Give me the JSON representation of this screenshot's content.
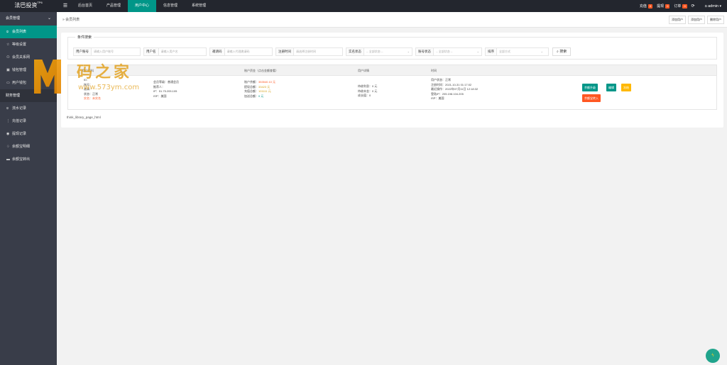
{
  "app": {
    "logo": "法巴投资",
    "logo_sup": "TP6",
    "menu_icon": "hamburger-icon"
  },
  "nav": [
    "后台首页",
    "产品管理",
    "用户中心",
    "信息管理",
    "系统管理"
  ],
  "topright": {
    "recharge": "充值",
    "recharge_count": "0",
    "withdraw": "提现",
    "withdraw_count": "0",
    "orders": "订单",
    "orders_count": "0",
    "refresh_icon": "refresh-icon",
    "user": "admin"
  },
  "sidebar": {
    "section": "会员管理",
    "items": [
      "会员列表",
      "等级设置",
      "会员关系网",
      "钱包管理",
      "用户钱包"
    ],
    "group": "财务管理",
    "finance_items": [
      "流水记录",
      "充值记录",
      "提现记录",
      "余额宝明细",
      "余额宝转出"
    ]
  },
  "breadcrumb": "会员列表",
  "tab_buttons": [
    "添加用户",
    "添加用户",
    "删除用户"
  ],
  "filters": {
    "legend": "条件搜索",
    "account_label": "用户账号",
    "account_placeholder": "请输入用户账号",
    "username_label": "用户名",
    "username_placeholder": "请输入用户名",
    "invite_label": "邀请码",
    "invite_placeholder": "请输入代理邀请码",
    "regtime_label": "注册时间",
    "regtime_placeholder": "请选择注册时间",
    "realname_label": "实名状态",
    "realname_value": "-- 全部状态 --",
    "account_status_label": "账号状态",
    "account_status_value": "-- 全部状态 --",
    "sort_label": "排序",
    "sort_value": "全部方式",
    "search_button": "搜索"
  },
  "table": {
    "headers": [
      "用户资料",
      "账户资金（点击金额查看）",
      "用户详情",
      "时间"
    ],
    "row": {
      "c1": [
        "ID：",
        "账号：",
        "邀请：",
        "状态：正常",
        "实名：未实名"
      ],
      "c2": [
        "会员等级：普通会员",
        "推荐人：",
        "IP：51.75.205.105",
        "ISP：美国"
      ],
      "c3_labels": [
        "账户余额：",
        "提现总额：",
        "充值总额：",
        "加送总额："
      ],
      "c3_values": [
        "353540.10 元",
        "33423 元",
        "101111 元",
        "0 元"
      ],
      "c4": [
        "待收利息：0 元",
        "待收本金：0 元",
        "成长值：0"
      ],
      "c5": [
        "用户状态：正常",
        "注册时间：2021-10-31 01:17:02",
        "最近操作：2022年07月11日 12:18:32",
        "登陆IP：205.198.104.205",
        "ISP：美国"
      ],
      "actions": [
        "余额升级",
        "编辑",
        "冻结",
        "余额宝转入"
      ]
    }
  },
  "pager": "think_library_page_html",
  "watermark": {
    "text": "码之家",
    "url": "www.573ym.com"
  },
  "colors": {
    "topbar": "#23262e",
    "sidebar": "#393d49",
    "accent": "#009688",
    "danger": "#ff5722",
    "warn": "#ffb800"
  }
}
